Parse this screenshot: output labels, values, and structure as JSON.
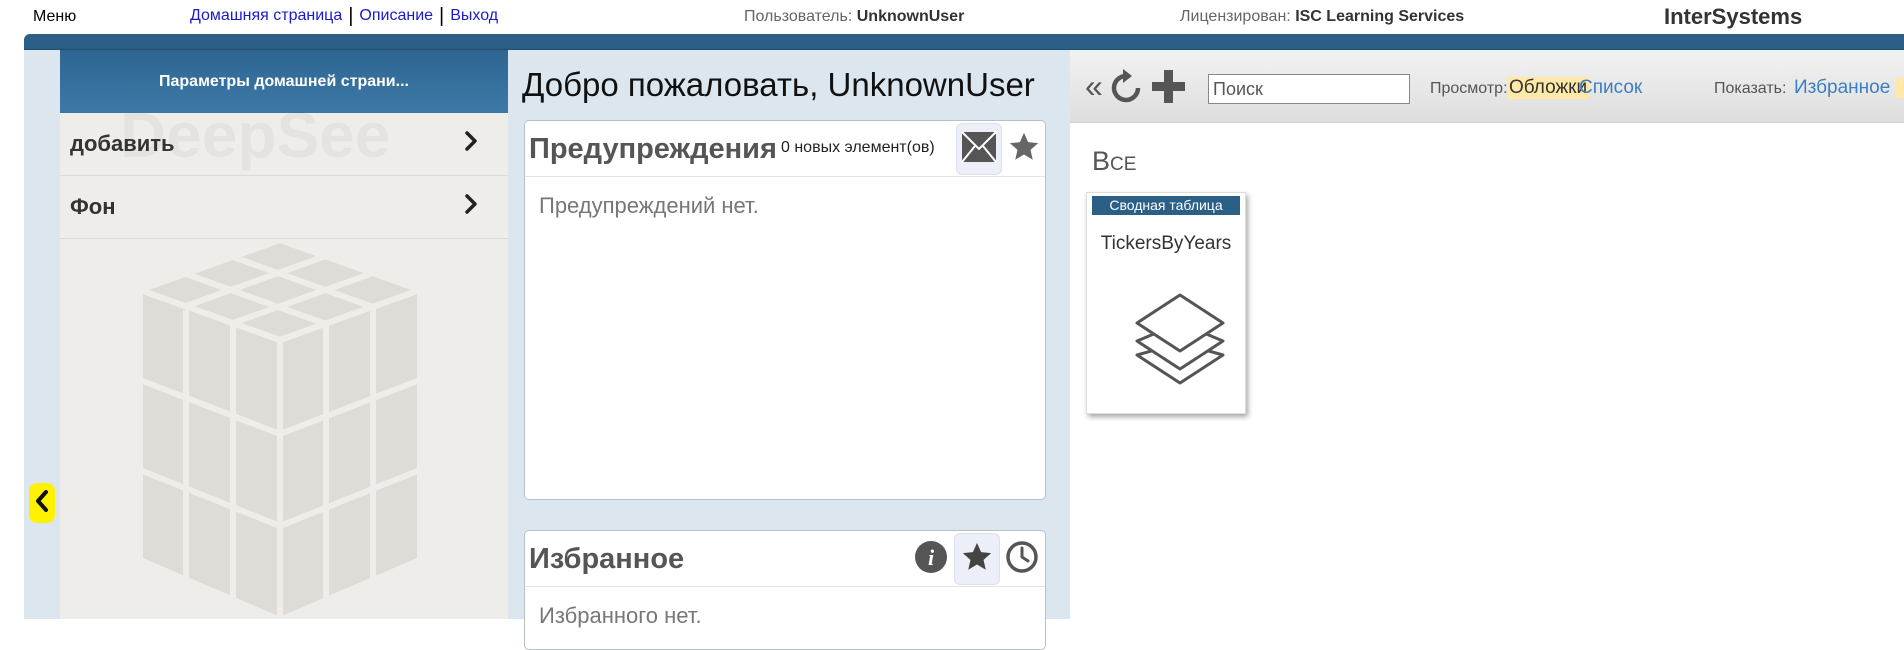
{
  "header": {
    "menu_label": "Меню",
    "links": [
      "Домашняя страница",
      "Описание",
      "Выход"
    ],
    "user_label": "Пользователь:",
    "user_value": "UnknownUser",
    "license_label": "Лицензирован:",
    "license_value": "ISC Learning Services",
    "brand": "InterSystems"
  },
  "left_panel": {
    "title": "Параметры домашней страни...",
    "watermark": "DeepSee",
    "items": [
      {
        "label": "добавить"
      },
      {
        "label": "Фон"
      }
    ]
  },
  "center": {
    "welcome": "Добро пожаловать, UnknownUser",
    "alerts": {
      "title": "Предупреждения",
      "count_text": "0 новых элемент(ов)",
      "empty_text": "Предупреждений нет."
    },
    "favorites": {
      "title": "Избранное",
      "empty_text": "Избранного нет."
    }
  },
  "right": {
    "back_symbol": "«",
    "search_placeholder": "Поиск",
    "view_label": "Просмотр:",
    "view_covers": "Обложки",
    "view_list": "Список",
    "show_label": "Показать:",
    "show_favorites": "Избранное",
    "section_title": "Все",
    "tiles": [
      {
        "type": "Сводная таблица",
        "name": "TickersByYears"
      }
    ]
  },
  "colors": {
    "frame_blue": "#2b5f86",
    "highlight_yellow": "#fff200",
    "link_blue": "#3a7fc2",
    "active_view_bg": "#ffe9a8"
  }
}
